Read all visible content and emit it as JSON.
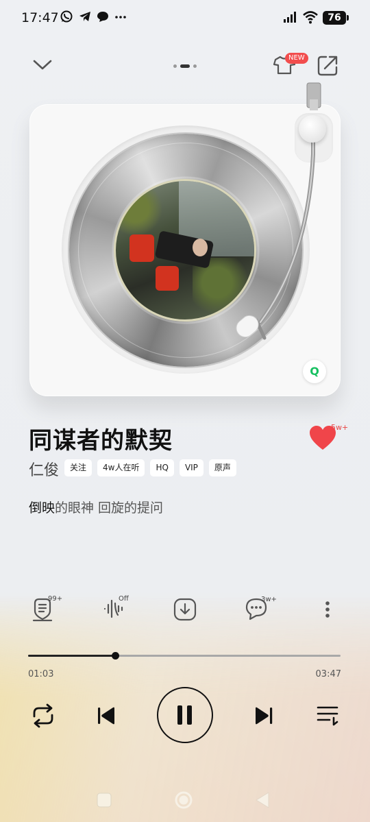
{
  "status_bar": {
    "time": "17:47",
    "battery": "76",
    "left_icons": [
      "whatsapp-icon",
      "telegram-icon",
      "message-icon",
      "more-dots-icon"
    ],
    "right_icons": [
      "signal-icon",
      "wifi-icon",
      "battery-icon"
    ]
  },
  "header": {
    "collapse_icon": "chevron-down-icon",
    "theme_badge": "NEW",
    "theme_icon": "tshirt-icon",
    "share_icon": "share-icon",
    "page_indicator": {
      "count": 3,
      "active_index": 1
    }
  },
  "player": {
    "cover_badge": "Q",
    "song_title": "同谋者的默契",
    "artist": "仁俊",
    "tags": [
      "关注",
      "4w人在听",
      "HQ",
      "VIP",
      "原声"
    ],
    "like_count": "5w+",
    "liked": true,
    "lyric_highlight": "倒映",
    "lyric_rest": "的眼神 回旋的提问"
  },
  "actions": {
    "comments_badge": "99+",
    "audio_effect_badge": "Off",
    "chat_badge": "3w+"
  },
  "progress": {
    "elapsed": "01:03",
    "total": "03:47",
    "fraction": 0.2775
  },
  "colors": {
    "like_red": "#f0454a",
    "badge_red": "#f24d4d",
    "qq_green": "#16c060"
  }
}
